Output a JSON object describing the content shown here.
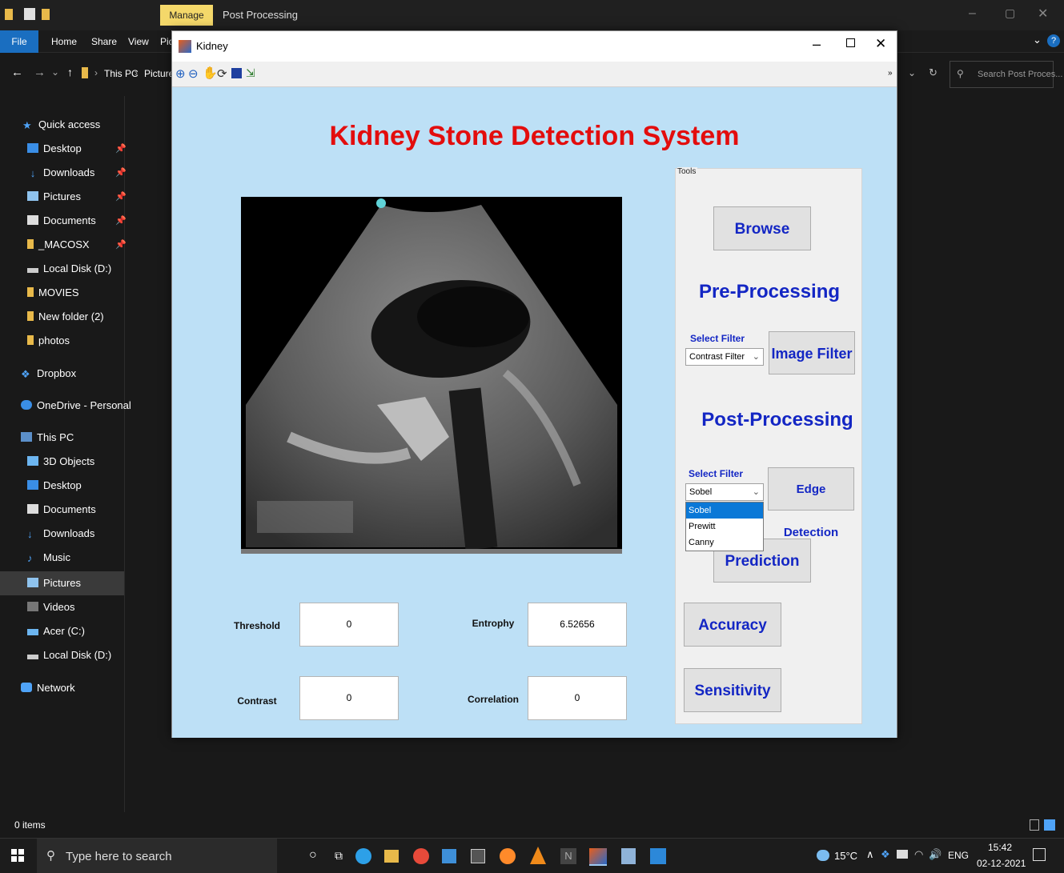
{
  "explorer": {
    "tab_manage": "Manage",
    "window_title": "Post Processing",
    "ribbon": [
      "File",
      "Home",
      "Share",
      "View",
      "Pic"
    ],
    "breadcrumb": [
      "This PC",
      "Picture"
    ],
    "search_placeholder": "Search Post Proces...",
    "nav": {
      "quick_access": "Quick access",
      "quick_items": [
        "Desktop",
        "Downloads",
        "Pictures",
        "Documents",
        "_MACOSX",
        "Local Disk (D:)",
        "MOVIES",
        "New folder (2)",
        "photos"
      ],
      "dropbox": "Dropbox",
      "onedrive": "OneDrive - Personal",
      "this_pc": "This PC",
      "pc_items": [
        "3D Objects",
        "Desktop",
        "Documents",
        "Downloads",
        "Music",
        "Pictures",
        "Videos",
        "Acer (C:)",
        "Local Disk (D:)"
      ],
      "network": "Network"
    },
    "status": "0 items"
  },
  "figure": {
    "title": "Kidney",
    "heading": "Kidney Stone Detection System",
    "tools_label": "Tools",
    "browse": "Browse",
    "pre_processing": "Pre-Processing",
    "post_processing": "Post-Processing",
    "select_filter_pre": "Select Filter",
    "pre_filter_value": "Contrast Filter",
    "image_filter": "Image Filter",
    "select_filter_post": "Select Filter",
    "post_filter_value": "Sobel",
    "post_filter_options": [
      "Sobel",
      "Prewitt",
      "Canny"
    ],
    "edge_detection": "Edge Detection",
    "prediction": "Prediction",
    "accuracy": "Accuracy",
    "sensitivity": "Sensitivity",
    "threshold_label": "Threshold",
    "threshold_value": "0",
    "entrophy_label": "Entrophy",
    "entrophy_value": "6.52656",
    "contrast_label": "Contrast",
    "contrast_value": "0",
    "correlation_label": "Correlation",
    "correlation_value": "0"
  },
  "taskbar": {
    "search_placeholder": "Type here to search",
    "weather": "15°C",
    "lang": "ENG",
    "time": "15:42",
    "date": "02-12-2021"
  },
  "colors": {
    "heading": "#e30d0d",
    "button_text": "#1326c4",
    "canvas": "#bde0f6"
  }
}
